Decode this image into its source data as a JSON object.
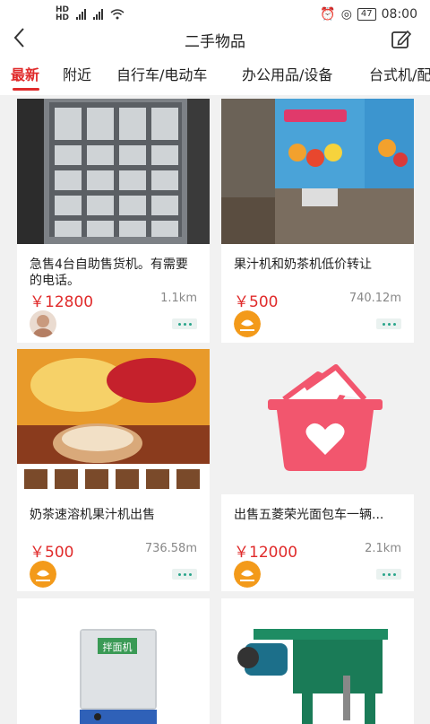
{
  "status": {
    "left_icons": [
      "HD 5G",
      "4G",
      "wifi"
    ],
    "time": "08:00",
    "battery": "47"
  },
  "header": {
    "title": "二手物品",
    "back_icon": "chevron-left-icon",
    "edit_icon": "edit-icon"
  },
  "tabs": [
    {
      "label": "最新",
      "active": true
    },
    {
      "label": "附近",
      "active": false
    },
    {
      "label": "自行车/电动车",
      "active": false
    },
    {
      "label": "办公用品/设备",
      "active": false
    },
    {
      "label": "台式机/配",
      "active": false
    }
  ],
  "listings": [
    {
      "title": "急售4台自助售货机。有需要的电话。",
      "price": "￥12800",
      "distance": "1.1km",
      "image_icon": "vending-machine-photo",
      "avatar": "user-photo-avatar"
    },
    {
      "title": "果汁机和奶茶机低价转让",
      "price": "￥500",
      "distance": "740.12m",
      "image_icon": "juice-machine-photo",
      "avatar": "orange-logo-avatar"
    },
    {
      "title": "奶茶速溶机果汁机出售",
      "price": "￥500",
      "distance": "736.58m",
      "image_icon": "milk-tea-machine-photo",
      "avatar": "orange-logo-avatar"
    },
    {
      "title": "出售五菱荣光面包车一辆...",
      "price": "￥12000",
      "distance": "2.1km",
      "image_icon": "basket-heart-placeholder",
      "avatar": "orange-logo-avatar"
    },
    {
      "title": "",
      "price": "",
      "distance": "",
      "image_icon": "dough-mixer-photo",
      "avatar": ""
    },
    {
      "title": "",
      "price": "",
      "distance": "",
      "image_icon": "green-machine-photo",
      "avatar": ""
    }
  ],
  "placeholder_label": "拌面机"
}
